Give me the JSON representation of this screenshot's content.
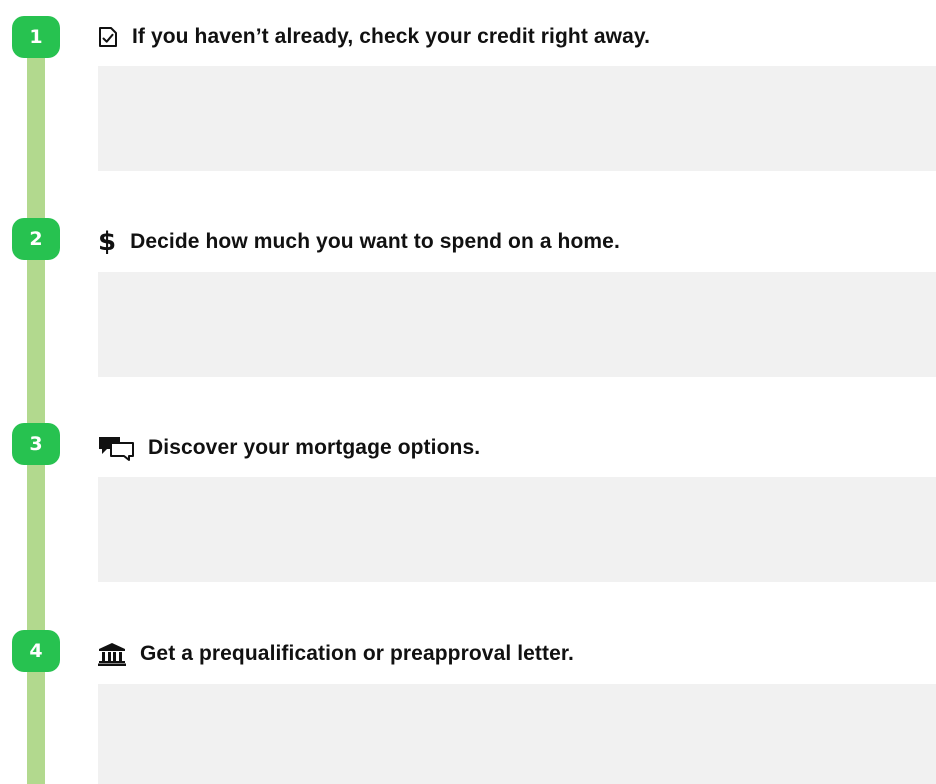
{
  "steps": [
    {
      "number": "1",
      "icon": "checklist-icon",
      "title": "If you haven’t already, check your credit right away."
    },
    {
      "number": "2",
      "icon": "dollar-icon",
      "title": "Decide how much you want to spend on a home."
    },
    {
      "number": "3",
      "icon": "chat-bubbles-icon",
      "title": "Discover your mortgage options."
    },
    {
      "number": "4",
      "icon": "bank-icon",
      "title": "Get a prequalification or preapproval letter."
    }
  ],
  "dollar_symbol": "$",
  "colors": {
    "badge": "#27c250",
    "timeline": "#b2d98e",
    "content_box": "#f1f1f1",
    "text": "#111111"
  }
}
